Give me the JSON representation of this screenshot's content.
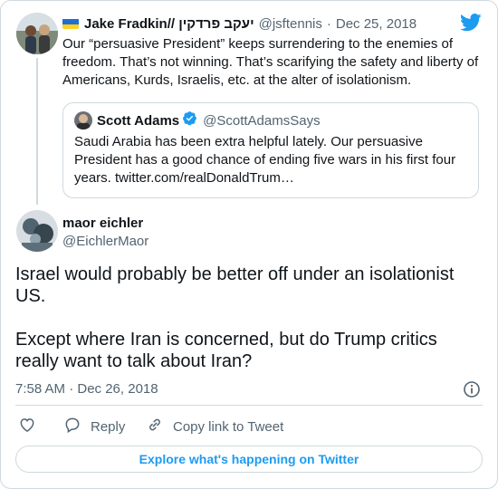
{
  "colors": {
    "accent": "#1d9bf0",
    "muted": "#536471",
    "border": "#cfd9de"
  },
  "reply_tweet": {
    "flag_icon": "ukraine-flag-emoji",
    "display_name": "Jake Fradkin// יעקב פרדקין",
    "handle": "@jsftennis",
    "separator": "·",
    "date": "Dec 25, 2018",
    "text": "Our “persuasive President” keeps surrendering to the enemies of freedom.  That’s not winning.  That’s scarifying the safety and liberty of Americans, Kurds, Israelis, etc. at the alter of isolationism."
  },
  "quoted_tweet": {
    "display_name": "Scott Adams",
    "handle": "@ScottAdamsSays",
    "text": "Saudi Arabia has been extra helpful lately. Our persuasive President has a good chance of ending five wars in his first four years. twitter.com/realDonaldTrum…"
  },
  "main_tweet": {
    "display_name": "maor eichler",
    "handle": "@EichlerMaor",
    "paragraph_1": "Israel would probably be better off under an isolationist US.",
    "paragraph_2": "Except where Iran is concerned, but do Trump critics really want to talk about Iran?",
    "timestamp": "7:58 AM · Dec 26, 2018"
  },
  "actions": {
    "reply_label": "Reply",
    "copy_link_label": "Copy link to Tweet"
  },
  "explore_label": "Explore what's happening on Twitter"
}
